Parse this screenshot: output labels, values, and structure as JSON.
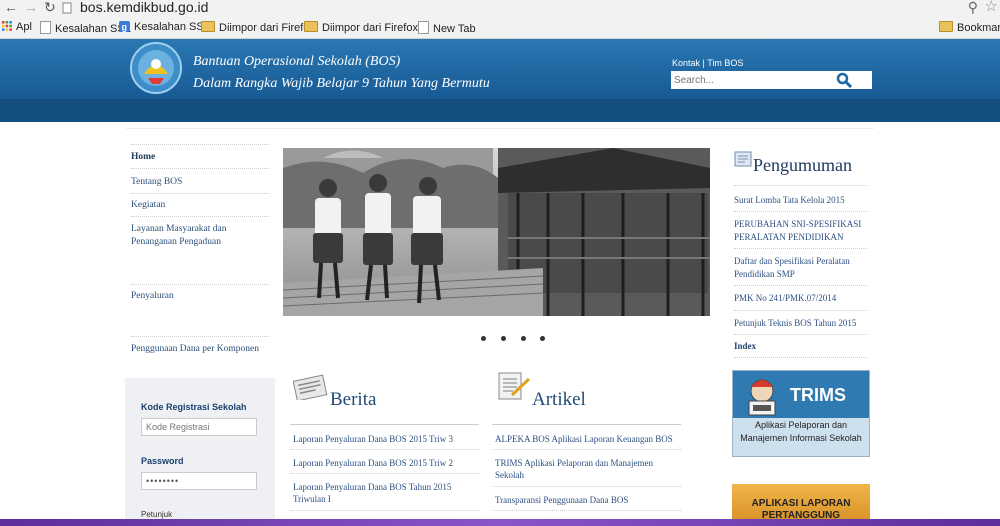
{
  "browser": {
    "url": "bos.kemdikbud.go.id",
    "bookmarks": [
      {
        "label": "Apl",
        "icon": "apps-icon"
      },
      {
        "label": "Kesalahan SSL",
        "icon": "page-icon"
      },
      {
        "label": "Kesalahan SSL",
        "icon": "google-icon"
      },
      {
        "label": "Diimpor dari Firefox",
        "icon": "folder-icon"
      },
      {
        "label": "Diimpor dari Firefox...",
        "icon": "folder-icon"
      },
      {
        "label": "New Tab",
        "icon": "page-icon"
      }
    ],
    "bookmark_right": "Bookmark l"
  },
  "header": {
    "title_line1": "Bantuan Operasional Sekolah (BOS)",
    "title_line2": "Dalam Rangka Wajib Belajar 9 Tahun Yang Bermutu",
    "link_kontak": "Kontak",
    "link_sep": "|",
    "link_tim": "Tim BOS",
    "search_placeholder": "Search..."
  },
  "left_nav": [
    {
      "label": "Home"
    },
    {
      "label": "Tentang BOS"
    },
    {
      "label": "Kegiatan"
    },
    {
      "label": "Layanan Masyarakat dan Penanganan Pengaduan"
    },
    {
      "label": "Penyaluran"
    },
    {
      "label": "Penggunaan Dana per Komponen"
    }
  ],
  "login": {
    "kode_label": "Kode Registrasi Sekolah",
    "kode_placeholder": "Kode Registrasi",
    "password_label": "Password",
    "password_value": "••••••••",
    "petunjuk": "Petunjuk"
  },
  "berita": {
    "title": "Berita",
    "items": [
      "Laporan Penyaluran Dana BOS 2015 Triw 3",
      "Laporan Penyaluran Dana BOS 2015 Triw 2",
      "Laporan Penyaluran Dana BOS Tahun 2015 Triwulan I"
    ]
  },
  "artikel": {
    "title": "Artikel",
    "items": [
      "ALPEKA BOS Aplikasi Laporan Keuangan BOS",
      "TRIMS Aplikasi Pelaporan dan Manajemen Sekolah",
      "Transparansi Penggunaan Dana BOS"
    ]
  },
  "pengumuman": {
    "title": "Pengumuman",
    "items": [
      "Surat Lomba Tata Kelola 2015",
      "PERUBAHAN SNI-SPESIFIKASI PERALATAN PENDIDIKAN",
      "Daftar dan Spesifikasi Peralatan Pendidikan SMP",
      "PMK No 241/PMK.07/2014",
      "Petunjuk Teknis BOS Tahun 2015"
    ],
    "index": "Index"
  },
  "trims": {
    "title": "TRIMS",
    "subtitle1": "Aplikasi Pelaporan dan",
    "subtitle2": "Manajemen Informasi Sekolah"
  },
  "aplikasi_banner": {
    "line1": "APLIKASI LAPORAN",
    "line2": "PERTANGGUNG"
  },
  "colors": {
    "header_blue": "#1f6aa5",
    "navbar_blue": "#144f80",
    "link_blue": "#2d5080",
    "taskbar": "#7c4db8"
  }
}
